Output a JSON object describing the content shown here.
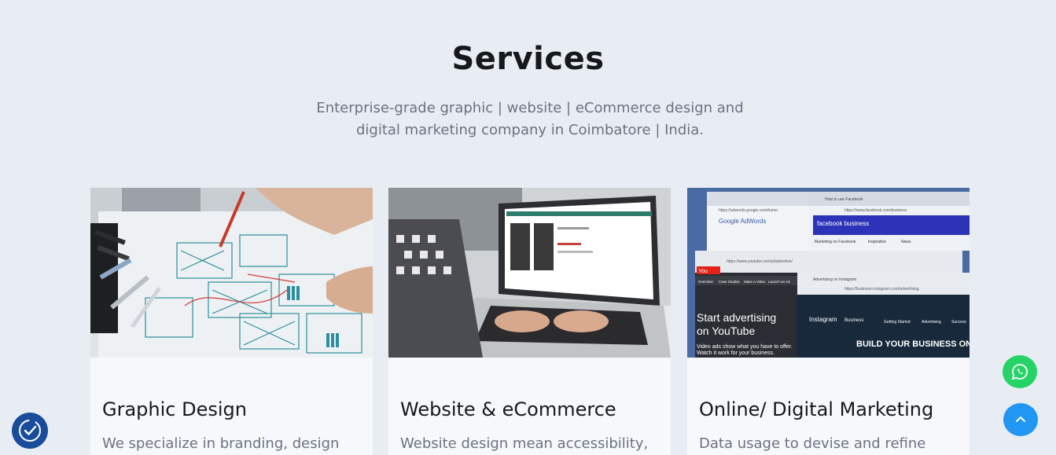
{
  "section": {
    "title": "Services",
    "subtitle_line1": "Enterprise-grade graphic | website | eCommerce design and",
    "subtitle_line2": "digital marketing company in Coimbatore | India."
  },
  "cards": [
    {
      "title": "Graphic Design",
      "description": "We specialize in branding, design"
    },
    {
      "title": "Website & eCommerce",
      "description": "Website design mean accessibility,"
    },
    {
      "title": "Online/ Digital Marketing",
      "description": "Data usage to devise and refine"
    }
  ],
  "card3_image": {
    "adwords_url": "https://adwords.google.com/home",
    "adwords_label": "Google AdWords",
    "fb_url": "https://www.facebook.com/business",
    "fb_label": "facebook business",
    "fb_tab": "How to use Facebook",
    "fb_nav": [
      "Marketing on Facebook",
      "Inspiration",
      "News"
    ],
    "yt_url": "https://www.youtube.com/yt/advertise/",
    "yt_nav": [
      "Overview",
      "Case Studies",
      "Make a Video",
      "Launch an Ad"
    ],
    "yt_headline1": "Start advertising",
    "yt_headline2": "on YouTube",
    "yt_body1": "Video ads show what you have to offer.",
    "yt_body2": "Watch it work for your business.",
    "ig_url": "https://business.instagram.com/advertising",
    "ig_tab": "Advertising on Instagram",
    "ig_nav": [
      "Instagram",
      "Business",
      "Getting Started",
      "Advertising",
      "Success"
    ],
    "ig_headline": "BUILD YOUR BUSINESS ON INST"
  },
  "colors": {
    "background": "#e8edf3",
    "card_background": "#f6f8fb",
    "whatsapp": "#25d366",
    "scroll_top": "#2196f3",
    "accessibility": "#1a4c9c"
  },
  "icons": {
    "whatsapp": "whatsapp-icon",
    "scroll_top": "chevron-up-icon",
    "accessibility": "accessibility-icon"
  }
}
